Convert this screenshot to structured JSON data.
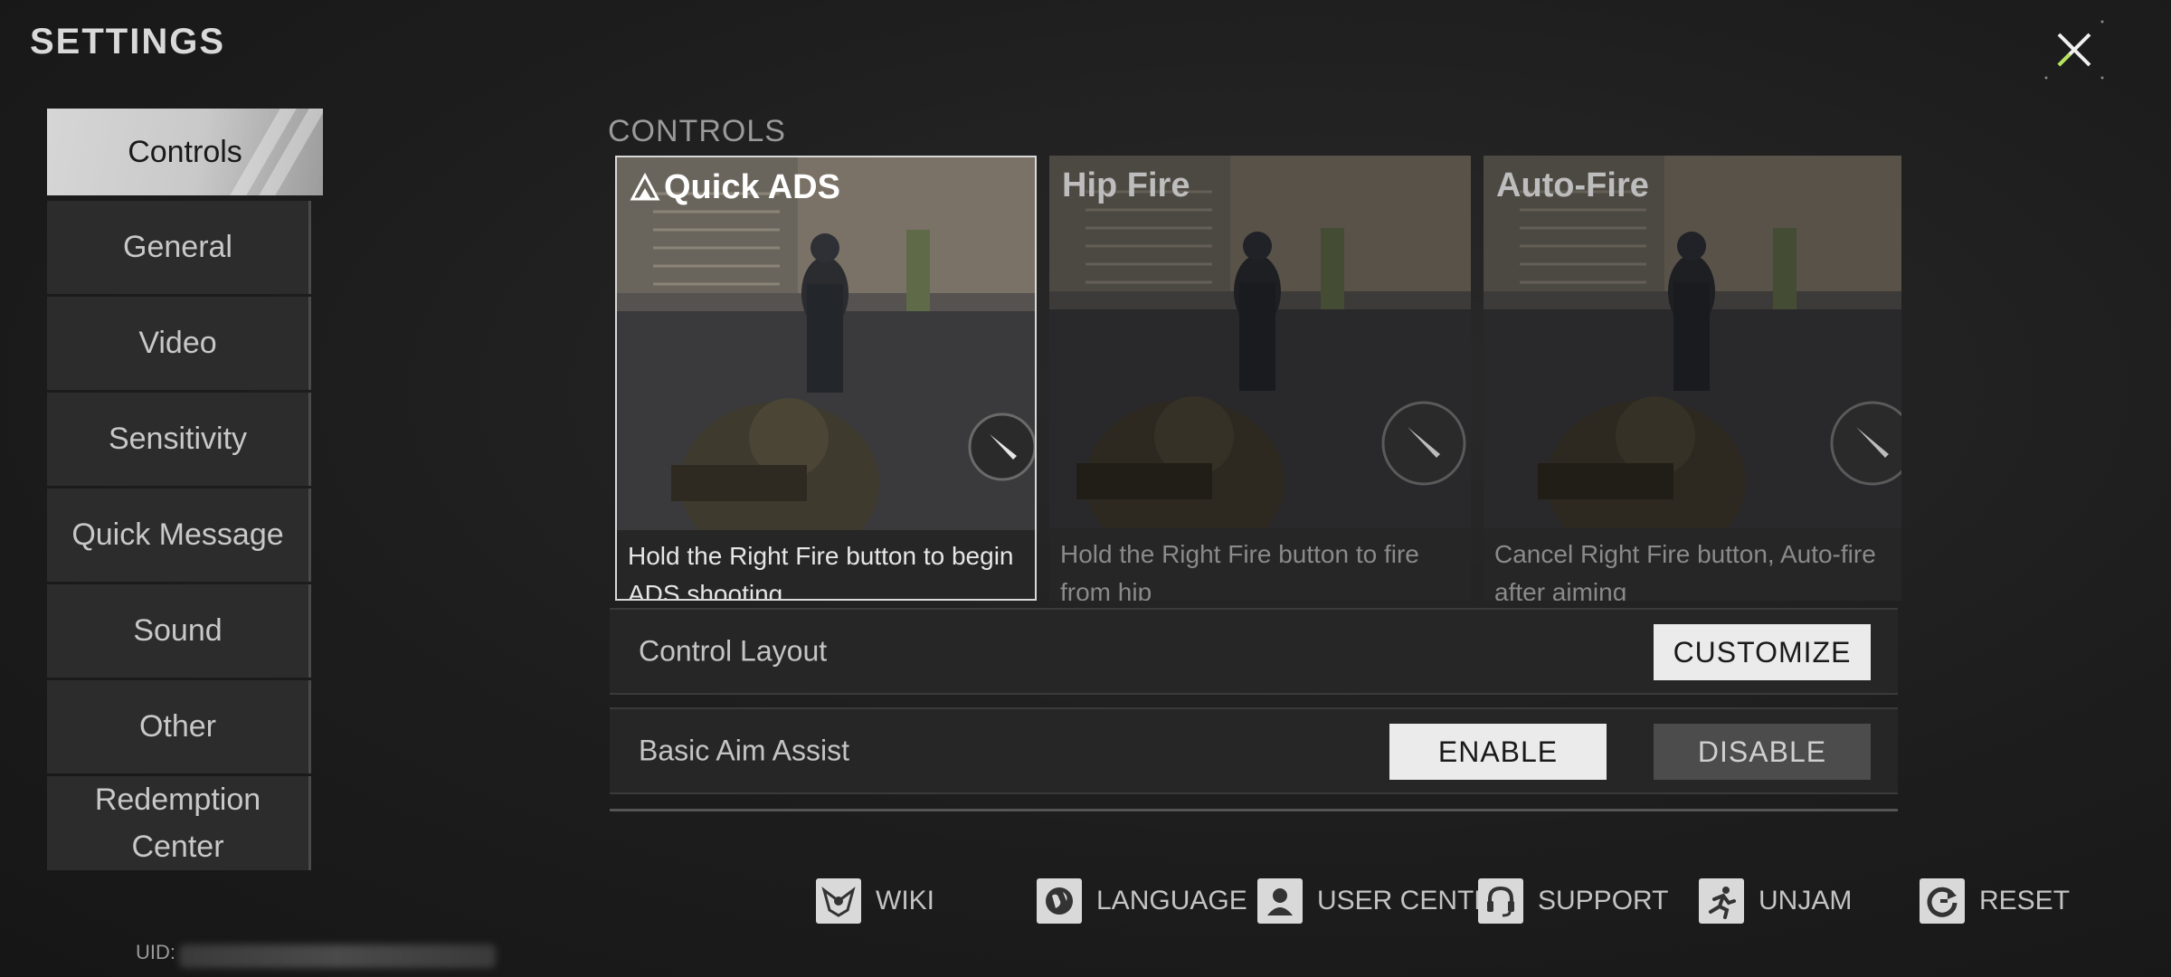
{
  "header": {
    "title": "SETTINGS",
    "close_icon": "close-icon"
  },
  "sidebar": {
    "items": [
      {
        "label": "Controls",
        "active": true
      },
      {
        "label": "General"
      },
      {
        "label": "Video"
      },
      {
        "label": "Sensitivity"
      },
      {
        "label": "Quick Message"
      },
      {
        "label": "Sound"
      },
      {
        "label": "Other"
      },
      {
        "label_line1": "Redemption",
        "label_line2": "Center"
      }
    ]
  },
  "uid_label": "UID:",
  "controls": {
    "section_title": "CONTROLS",
    "modes": [
      {
        "title": "Quick ADS",
        "caption": "Hold the Right Fire button to begin ADS shooting",
        "selected": true,
        "icon": "selected-triangle-icon"
      },
      {
        "title": "Hip Fire",
        "caption": "Hold the Right Fire button to fire from hip",
        "selected": false
      },
      {
        "title": "Auto-Fire",
        "caption": "Cancel Right Fire button, Auto-fire after aiming",
        "selected": false
      }
    ],
    "control_layout": {
      "label": "Control Layout",
      "button": "CUSTOMIZE"
    },
    "aim_assist": {
      "label": "Basic Aim Assist",
      "enable": "ENABLE",
      "disable": "DISABLE",
      "selected": "ENABLE"
    }
  },
  "toolbar": {
    "wiki": "WIKI",
    "language": "LANGUAGE",
    "user_center": "USER CENTER",
    "support": "SUPPORT",
    "unjam": "UNJAM",
    "reset": "RESET"
  },
  "colors": {
    "accent": "#ebebeb",
    "close_accent": "#b6e35a"
  }
}
